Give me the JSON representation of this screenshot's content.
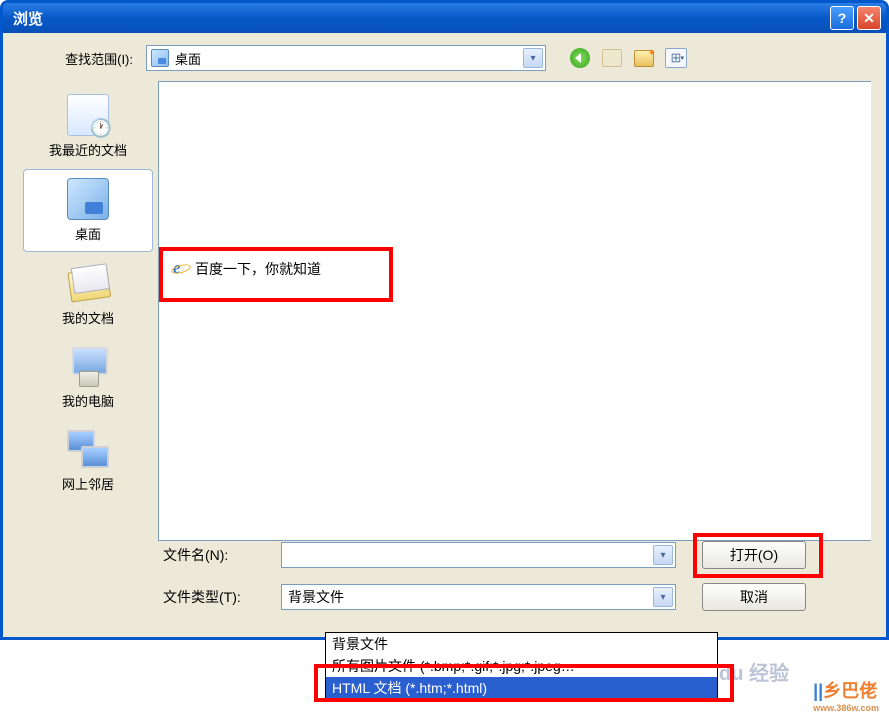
{
  "titlebar": {
    "title": "浏览"
  },
  "lookin": {
    "label": "查找范围(I):",
    "value": "桌面"
  },
  "sidebar": {
    "items": [
      {
        "label": "我最近的文档"
      },
      {
        "label": "桌面"
      },
      {
        "label": "我的文档"
      },
      {
        "label": "我的电脑"
      },
      {
        "label": "网上邻居"
      }
    ]
  },
  "filepane": {
    "item": "百度一下，你就知道"
  },
  "fields": {
    "filename_label": "文件名(N):",
    "filename_value": "",
    "filetype_label": "文件类型(T):",
    "filetype_value": "背景文件"
  },
  "buttons": {
    "open": "打开(O)",
    "cancel": "取消"
  },
  "dropdown": {
    "items": [
      "背景文件",
      "所有图片文件 (*.bmp;*.gif;*.jpg;*.jpeg…",
      "HTML 文档 (*.htm;*.html)"
    ]
  },
  "watermarks": {
    "w1": "Baidu 经验",
    "w2_main": "乡巴佬",
    "w2_sub": "www.386w.com"
  }
}
